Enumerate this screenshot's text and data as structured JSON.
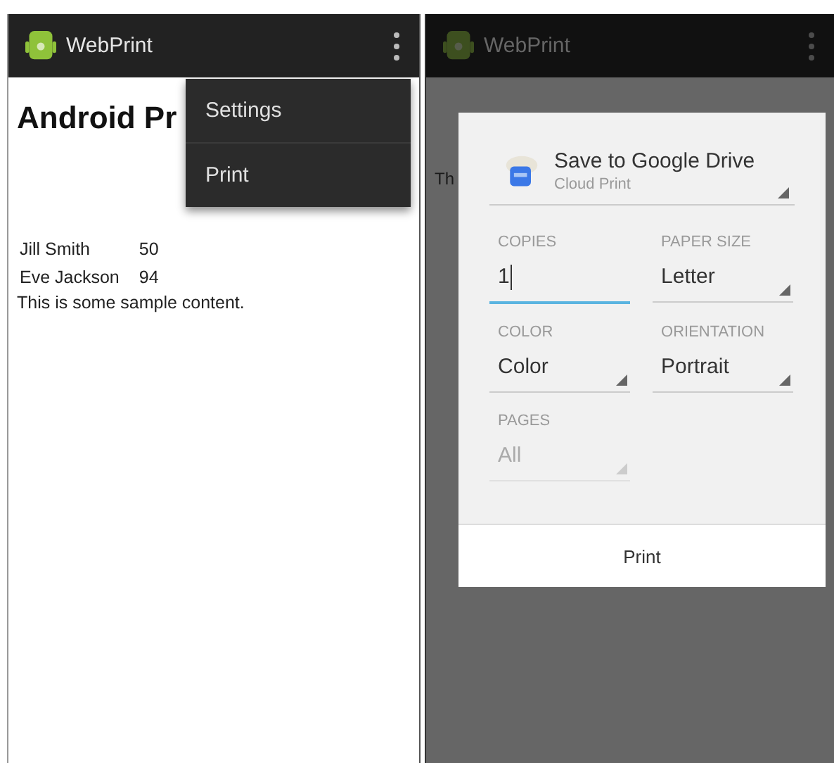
{
  "left_screen": {
    "app_bar": {
      "title": "WebPrint",
      "dimmed": false
    },
    "heading": "Android Pr",
    "overflow_menu": {
      "items": [
        {
          "label": "Settings"
        },
        {
          "label": "Print"
        }
      ]
    },
    "table_rows": [
      {
        "name": "Jill  Smith",
        "score": "50"
      },
      {
        "name": "Eve Jackson",
        "score": "94"
      }
    ],
    "paragraph": "This is some sample content."
  },
  "right_screen": {
    "app_bar": {
      "title": "WebPrint",
      "dimmed": true
    },
    "partial_text": "Th",
    "print_dialog": {
      "destination": {
        "name": "Save to Google Drive",
        "subtitle": "Cloud Print"
      },
      "fields": [
        {
          "label": "COPIES",
          "value": "1",
          "kind": "input",
          "focused": true,
          "disabled": false
        },
        {
          "label": "PAPER SIZE",
          "value": "Letter",
          "kind": "dropdown",
          "focused": false,
          "disabled": false
        },
        {
          "label": "COLOR",
          "value": "Color",
          "kind": "dropdown",
          "focused": false,
          "disabled": false
        },
        {
          "label": "ORIENTATION",
          "value": "Portrait",
          "kind": "dropdown",
          "focused": false,
          "disabled": false
        },
        {
          "label": "PAGES",
          "value": "All",
          "kind": "dropdown",
          "focused": false,
          "disabled": true
        }
      ],
      "button": "Print"
    }
  }
}
